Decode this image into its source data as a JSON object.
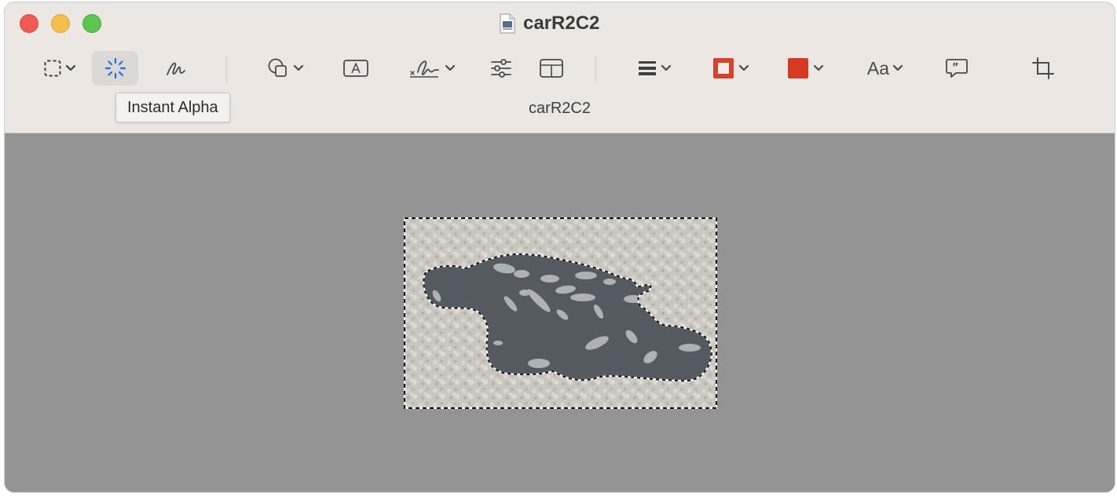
{
  "window": {
    "title": "carR2C2",
    "document_label": "carR2C2"
  },
  "toolbar": {
    "tools": [
      {
        "name": "rectangular-selection",
        "icon": "dashed-rect-icon",
        "has_menu": true
      },
      {
        "name": "instant-alpha",
        "icon": "magic-wand-icon",
        "active": true
      },
      {
        "name": "sketch",
        "icon": "sketch-icon"
      },
      {
        "name": "shapes",
        "icon": "shapes-icon",
        "has_menu": true
      },
      {
        "name": "text",
        "icon": "text-box-icon"
      },
      {
        "name": "sign",
        "icon": "signature-icon",
        "has_menu": true
      },
      {
        "name": "adjust-color",
        "icon": "sliders-icon"
      },
      {
        "name": "adjust-size",
        "icon": "resize-icon"
      },
      {
        "name": "shape-style",
        "icon": "line-weight-icon",
        "has_menu": true
      },
      {
        "name": "border-color",
        "icon": "border-color-icon",
        "has_menu": true
      },
      {
        "name": "fill-color",
        "icon": "fill-color-icon",
        "has_menu": true
      },
      {
        "name": "text-style",
        "icon": "font-icon",
        "label": "Aa",
        "has_menu": true
      },
      {
        "name": "notes",
        "icon": "speech-bubble-icon"
      },
      {
        "name": "crop",
        "icon": "crop-icon"
      }
    ],
    "tooltip": "Instant Alpha"
  },
  "colors": {
    "accent": "#1f6fe0",
    "border_color": "#d6422b",
    "fill_color": "#d63a22",
    "canvas_bg": "#949494",
    "titlebar_bg": "#ece7e3"
  }
}
